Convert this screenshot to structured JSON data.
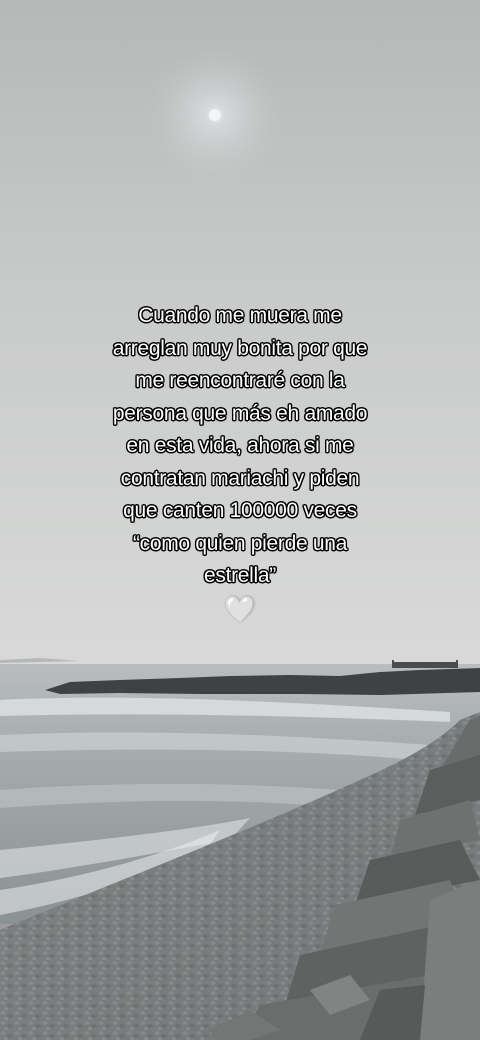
{
  "caption": {
    "lines": [
      "Cuando me muera me",
      "arreglan muy bonita por que",
      "me reencontraré con la",
      "persona que más eh amado",
      "en esta vida, ahora si me",
      "contratan mariachi y piden",
      "que canten 100000 veces",
      "“como quien pierde una",
      "estrella”"
    ],
    "emoji": "🤍"
  },
  "colors": {
    "sky_top": "#b9bbbb",
    "sky_bottom": "#d6d7d6",
    "sea": "#9ea3a4",
    "foam": "#e6e8e8",
    "pebbles": "#77797a",
    "rocks": "#5e5f5f",
    "text": "#ffffff",
    "text_outline": "#000000"
  }
}
